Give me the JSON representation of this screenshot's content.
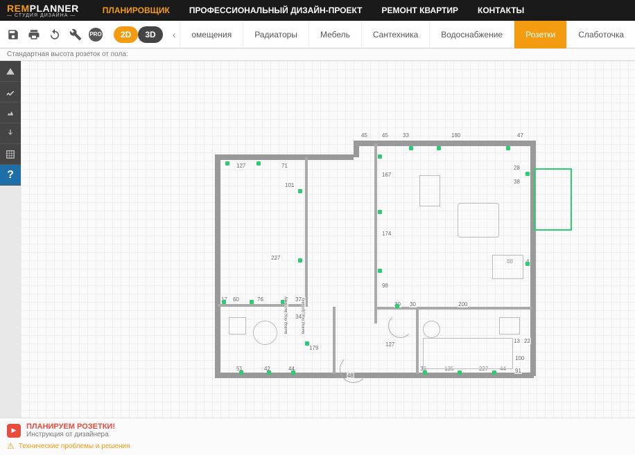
{
  "logo": {
    "rem": "REM",
    "planner": "PLANNER",
    "sub": "— СТУДИЯ ДИЗАЙНА —"
  },
  "topnav": {
    "items": [
      {
        "label": "ПЛАНИРОВЩИК",
        "active": true
      },
      {
        "label": "ПРОФЕССИОНАЛЬНЫЙ ДИЗАЙН-ПРОЕКТ",
        "active": false
      },
      {
        "label": "РЕМОНТ КВАРТИР",
        "active": false
      },
      {
        "label": "КОНТАКТЫ",
        "active": false
      }
    ]
  },
  "toolbar": {
    "pro_label": "PRO",
    "view": {
      "d2": "2D",
      "d3": "3D"
    },
    "categories": [
      {
        "label": "омещения",
        "active": false
      },
      {
        "label": "Радиаторы",
        "active": false
      },
      {
        "label": "Мебель",
        "active": false
      },
      {
        "label": "Сантехника",
        "active": false
      },
      {
        "label": "Водоснабжение",
        "active": false
      },
      {
        "label": "Розетки",
        "active": true
      },
      {
        "label": "Слаботочка",
        "active": false
      }
    ]
  },
  "status": "Стандартная высота розеток от пола:",
  "sidetool_help": "?",
  "dimensions": {
    "top": [
      "45",
      "45",
      "33",
      "180",
      "47"
    ],
    "room_left": [
      "127",
      "71",
      "101",
      "227",
      "17",
      "60",
      "76",
      "8",
      "37",
      "34",
      "51",
      "42",
      "44",
      "179",
      "48"
    ],
    "room_center": [
      "167",
      "174",
      "98",
      "30",
      "30",
      "200",
      "127",
      "33",
      "135",
      "227",
      "44"
    ],
    "room_right": [
      "28",
      "38",
      "88",
      "4",
      "13",
      "22",
      "100",
      "91"
    ],
    "labels": [
      "вывод под вытяжку",
      "вывод под духовку"
    ]
  },
  "bottom": {
    "notice_title": "ПЛАНИРУЕМ РОЗЕТКИ!",
    "notice_sub": "Инструкция от дизайнера",
    "tech": "Технические проблемы и решения"
  }
}
